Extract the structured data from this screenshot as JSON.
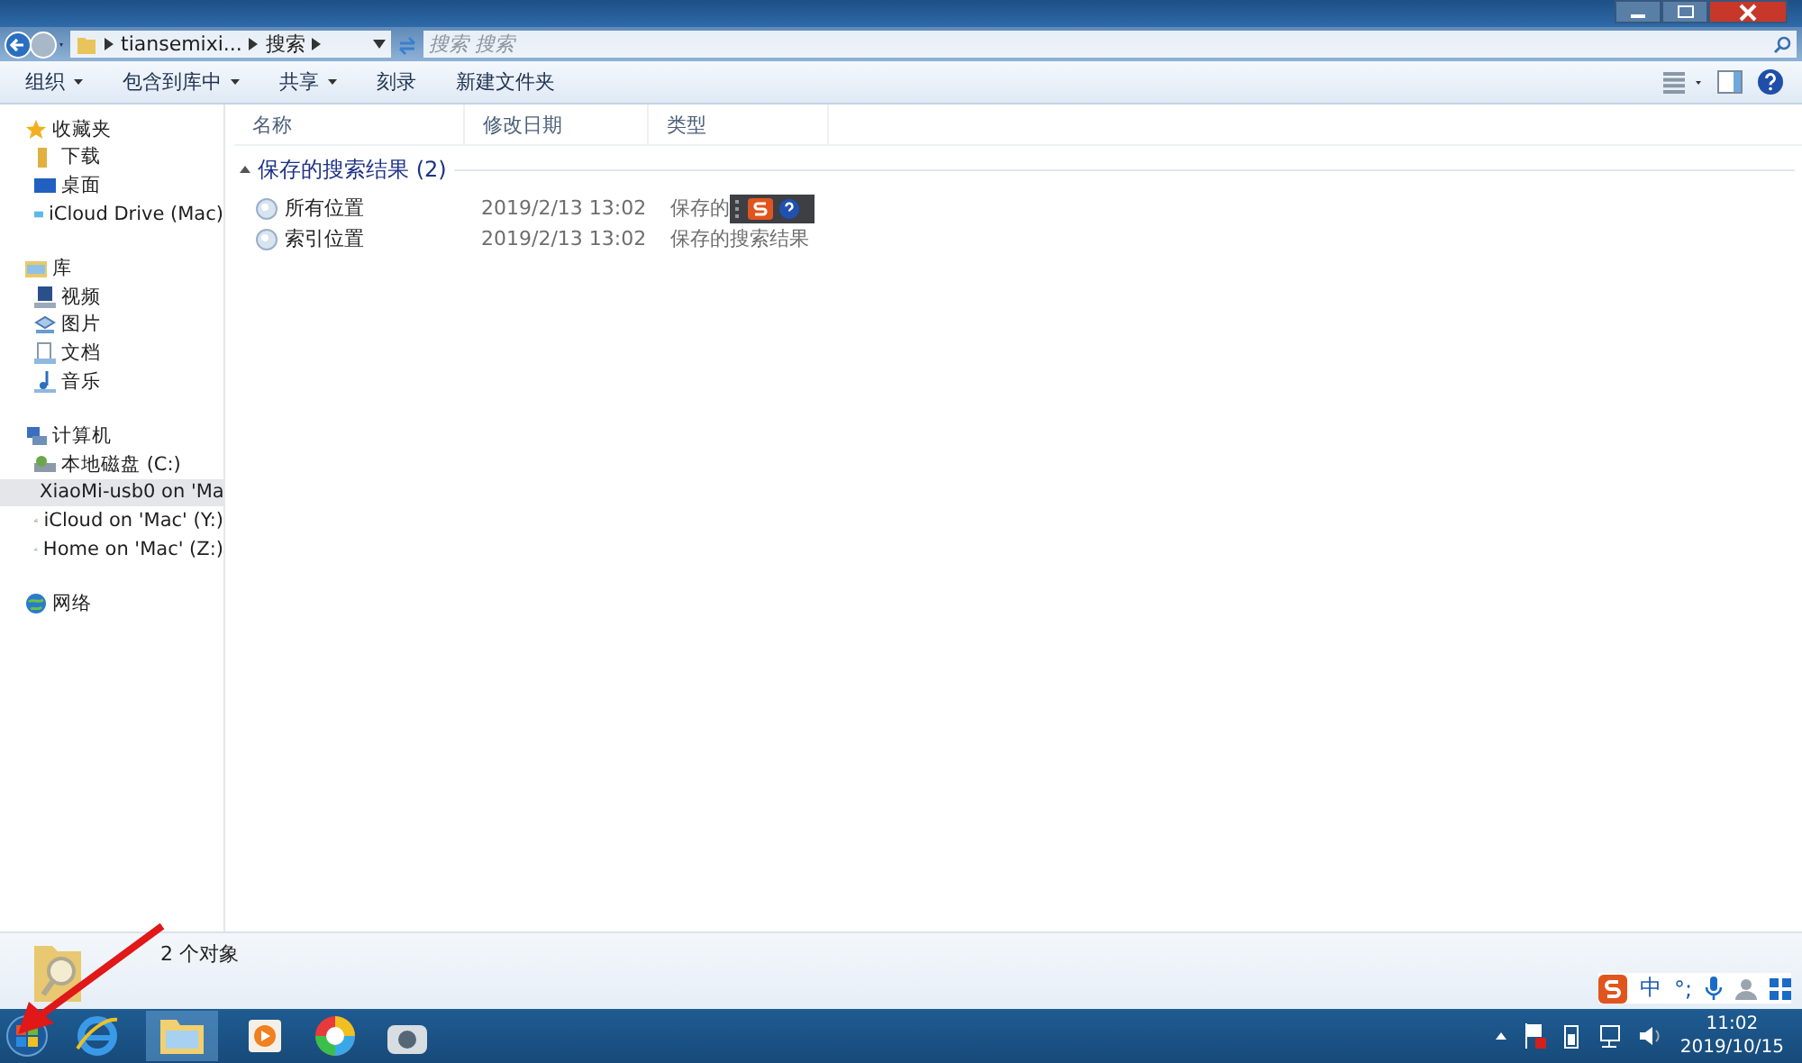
{
  "address_bar": {
    "crumbs": [
      "tiansemixi...",
      "搜索"
    ],
    "search_placeholder": "搜索 搜索"
  },
  "toolbar": {
    "items": [
      {
        "label": "组织",
        "dropdown": true
      },
      {
        "label": "包含到库中",
        "dropdown": true
      },
      {
        "label": "共享",
        "dropdown": true
      },
      {
        "label": "刻录",
        "dropdown": false
      },
      {
        "label": "新建文件夹",
        "dropdown": false
      }
    ]
  },
  "nav": {
    "groups": [
      {
        "label": "收藏夹",
        "items": [
          {
            "label": "下载",
            "selected": false
          },
          {
            "label": "桌面",
            "selected": false
          },
          {
            "label": "iCloud Drive (Mac)",
            "selected": false
          }
        ]
      },
      {
        "label": "库",
        "items": [
          {
            "label": "视频",
            "selected": false
          },
          {
            "label": "图片",
            "selected": false
          },
          {
            "label": "文档",
            "selected": false
          },
          {
            "label": "音乐",
            "selected": false
          }
        ]
      },
      {
        "label": "计算机",
        "items": [
          {
            "label": "本地磁盘 (C:)",
            "selected": false
          },
          {
            "label": "XiaoMi-usb0 on 'Ma",
            "selected": true
          },
          {
            "label": "iCloud on 'Mac' (Y:)",
            "selected": false
          },
          {
            "label": "Home on 'Mac' (Z:)",
            "selected": false
          }
        ]
      },
      {
        "label": "网络"
      }
    ]
  },
  "table": {
    "columns": [
      "名称",
      "修改日期",
      "类型"
    ],
    "group": "保存的搜索结果 (2)",
    "rows": [
      [
        "所有位置",
        "2019/2/13 13:02",
        "保存的"
      ],
      [
        "索引位置",
        "2019/2/13 13:02",
        "保存的搜索结果"
      ]
    ]
  },
  "details": {
    "text": "2 个对象"
  },
  "tray": {
    "ime": [
      "中",
      "°;"
    ],
    "time": "11:02",
    "date": "2019/10/15"
  }
}
